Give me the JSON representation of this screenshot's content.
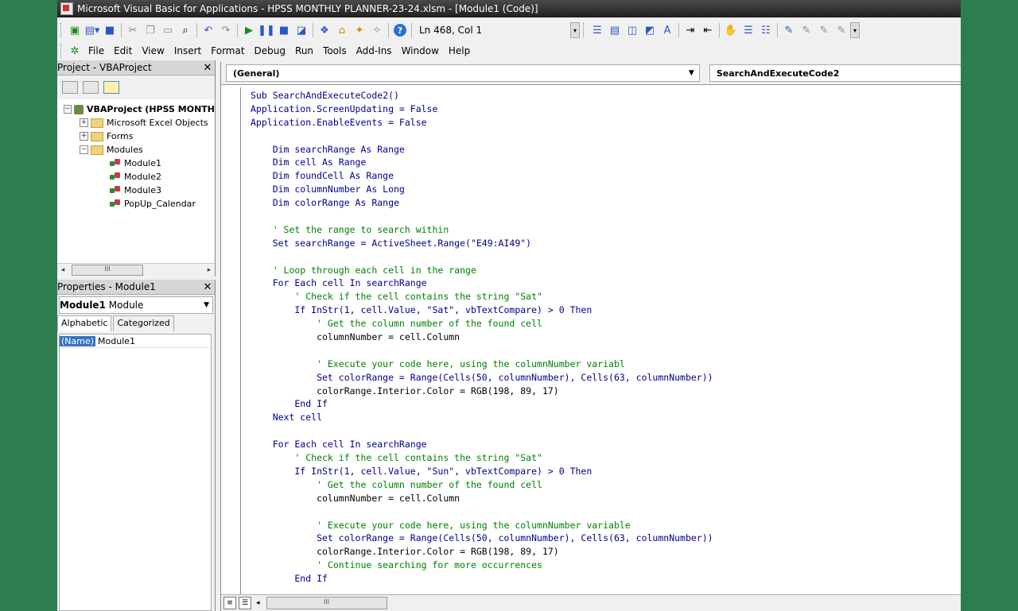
{
  "window": {
    "title": "Microsoft Visual Basic for Applications - HPSS MONTHLY PLANNER-23-24.xlsm - [Module1 (Code)]"
  },
  "toolbar": {
    "cursor_position": "Ln 468, Col 1",
    "icons": [
      "excel-icon",
      "insert-userform-icon",
      "save-icon",
      "cut-icon",
      "copy-icon",
      "paste-icon",
      "find-icon",
      "undo-icon",
      "redo-icon",
      "run-icon",
      "break-icon",
      "reset-icon",
      "design-mode-icon",
      "project-explorer-icon",
      "properties-icon",
      "object-browser-icon",
      "toolbox-icon",
      "help-icon"
    ]
  },
  "menu": {
    "items": [
      "File",
      "Edit",
      "View",
      "Insert",
      "Format",
      "Debug",
      "Run",
      "Tools",
      "Add-Ins",
      "Window",
      "Help"
    ]
  },
  "project": {
    "title": "Project - VBAProject",
    "root": "VBAProject (HPSS MONTH",
    "nodes": [
      "Microsoft Excel Objects",
      "Forms",
      "Modules"
    ],
    "modules": [
      "Module1",
      "Module2",
      "Module3",
      "PopUp_Calendar"
    ],
    "scroll_label": "III"
  },
  "properties": {
    "title": "Properties - Module1",
    "object_name": "Module1",
    "object_type": "Module",
    "tabs": [
      "Alphabetic",
      "Categorized"
    ],
    "rows": [
      {
        "name": "(Name)",
        "value": "Module1"
      }
    ]
  },
  "code": {
    "object_dropdown": "(General)",
    "proc_dropdown": "SearchAndExecuteCode2",
    "scroll_label": "III",
    "lines": [
      {
        "text": "Sub SearchAndExecuteCode2()",
        "kind": "kw"
      },
      {
        "text": "Application.ScreenUpdating = False",
        "kind": "kw"
      },
      {
        "text": "Application.EnableEvents = False",
        "kind": "kw"
      },
      {
        "text": "",
        "kind": ""
      },
      {
        "text": "    Dim searchRange As Range",
        "kind": "kw"
      },
      {
        "text": "    Dim cell As Range",
        "kind": "kw"
      },
      {
        "text": "    Dim foundCell As Range",
        "kind": "kw"
      },
      {
        "text": "    Dim columnNumber As Long",
        "kind": "kw"
      },
      {
        "text": "    Dim colorRange As Range",
        "kind": "kw"
      },
      {
        "text": "",
        "kind": ""
      },
      {
        "text": "    ' Set the range to search within",
        "kind": "cm"
      },
      {
        "text": "    Set searchRange = ActiveSheet.Range(\"E49:AI49\")",
        "kind": "kw"
      },
      {
        "text": "",
        "kind": ""
      },
      {
        "text": "    ' Loop through each cell in the range",
        "kind": "cm"
      },
      {
        "text": "    For Each cell In searchRange",
        "kind": "kw"
      },
      {
        "text": "        ' Check if the cell contains the string \"Sat\"",
        "kind": "cm"
      },
      {
        "text": "        If InStr(1, cell.Value, \"Sat\", vbTextCompare) > 0 Then",
        "kind": "kw"
      },
      {
        "text": "            ' Get the column number of the found cell",
        "kind": "cm"
      },
      {
        "text": "            columnNumber = cell.Column",
        "kind": ""
      },
      {
        "text": "",
        "kind": ""
      },
      {
        "text": "            ' Execute your code here, using the columnNumber variabl",
        "kind": "cm"
      },
      {
        "text": "            Set colorRange = Range(Cells(50, columnNumber), Cells(63, columnNumber))",
        "kind": "kw"
      },
      {
        "text": "            colorRange.Interior.Color = RGB(198, 89, 17)",
        "kind": ""
      },
      {
        "text": "        End If",
        "kind": "kw"
      },
      {
        "text": "    Next cell",
        "kind": "kw"
      },
      {
        "text": "",
        "kind": ""
      },
      {
        "text": "    For Each cell In searchRange",
        "kind": "kw"
      },
      {
        "text": "        ' Check if the cell contains the string \"Sat\"",
        "kind": "cm"
      },
      {
        "text": "        If InStr(1, cell.Value, \"Sun\", vbTextCompare) > 0 Then",
        "kind": "kw"
      },
      {
        "text": "            ' Get the column number of the found cell",
        "kind": "cm"
      },
      {
        "text": "            columnNumber = cell.Column",
        "kind": ""
      },
      {
        "text": "",
        "kind": ""
      },
      {
        "text": "            ' Execute your code here, using the columnNumber variable",
        "kind": "cm"
      },
      {
        "text": "            Set colorRange = Range(Cells(50, columnNumber), Cells(63, columnNumber))",
        "kind": "kw"
      },
      {
        "text": "            colorRange.Interior.Color = RGB(198, 89, 17)",
        "kind": ""
      },
      {
        "text": "            ' Continue searching for more occurrences",
        "kind": "cm"
      },
      {
        "text": "        End If",
        "kind": "kw"
      }
    ]
  }
}
